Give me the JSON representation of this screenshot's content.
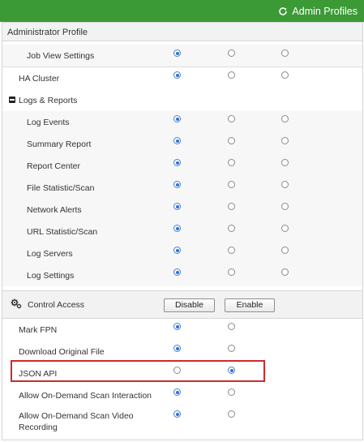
{
  "header": {
    "admin_profiles_label": "Admin Profiles",
    "accent_color": "#3c9a36"
  },
  "section": {
    "title": "Administrator Profile"
  },
  "rows_top": [
    {
      "label": "Job View Settings",
      "selected": 0
    },
    {
      "label": "HA Cluster",
      "selected": 0
    },
    {
      "label": "Logs & Reports",
      "group": true
    },
    {
      "label": "Log Events",
      "selected": 0
    },
    {
      "label": "Summary Report",
      "selected": 0
    },
    {
      "label": "Report Center",
      "selected": 0
    },
    {
      "label": "File Statistic/Scan",
      "selected": 0
    },
    {
      "label": "Network Alerts",
      "selected": 0
    },
    {
      "label": "URL Statistic/Scan",
      "selected": 0
    },
    {
      "label": "Log Servers",
      "selected": 0
    },
    {
      "label": "Log Settings",
      "selected": 0
    }
  ],
  "control_access": {
    "label": "Control Access",
    "disable_label": "Disable",
    "enable_label": "Enable"
  },
  "rows_bottom": [
    {
      "label": "Mark FPN",
      "selected": 0
    },
    {
      "label": "Download Original File",
      "selected": 0
    },
    {
      "label": "JSON API",
      "selected": 1,
      "highlighted": true
    },
    {
      "label": "Allow On-Demand Scan Interaction",
      "selected": 0
    },
    {
      "label": "Allow On-Demand Scan Video Recording",
      "selected": 0
    }
  ],
  "icons": {
    "refresh": "refresh-icon",
    "collapse": "minus-square-icon",
    "control": "settings-gear-icon"
  },
  "highlight_color": "#cc2b2b"
}
